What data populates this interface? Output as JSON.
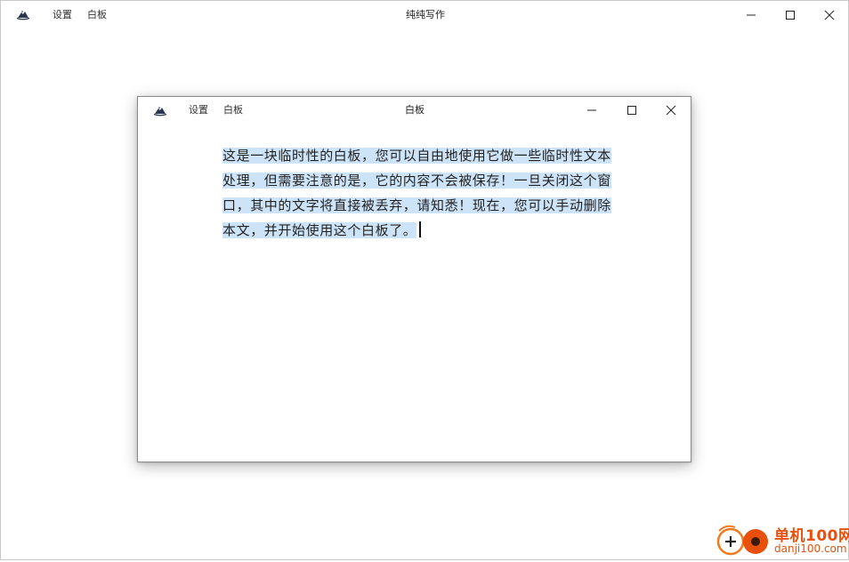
{
  "main_window": {
    "title": "纯纯写作",
    "menu": [
      "设置",
      "白板"
    ],
    "controls": [
      "minimize-icon",
      "maximize-icon",
      "close-icon"
    ]
  },
  "board_window": {
    "title": "白板",
    "menu": [
      "设置",
      "白板"
    ],
    "text": "这是一块临时性的白板，您可以自由地使用它做一些临时性文本处理，但需要注意的是，它的内容不会被保存！一旦关闭这个窗口，其中的文字将直接被丢弃，请知悉！现在，您可以手动删除本文，并开始使用这个白板了。",
    "text_selected": true
  },
  "watermark": {
    "cn": "单机100网",
    "en": "danji100.com"
  },
  "colors": {
    "selection": "#cde3f7",
    "watermark": "#e8500c"
  }
}
